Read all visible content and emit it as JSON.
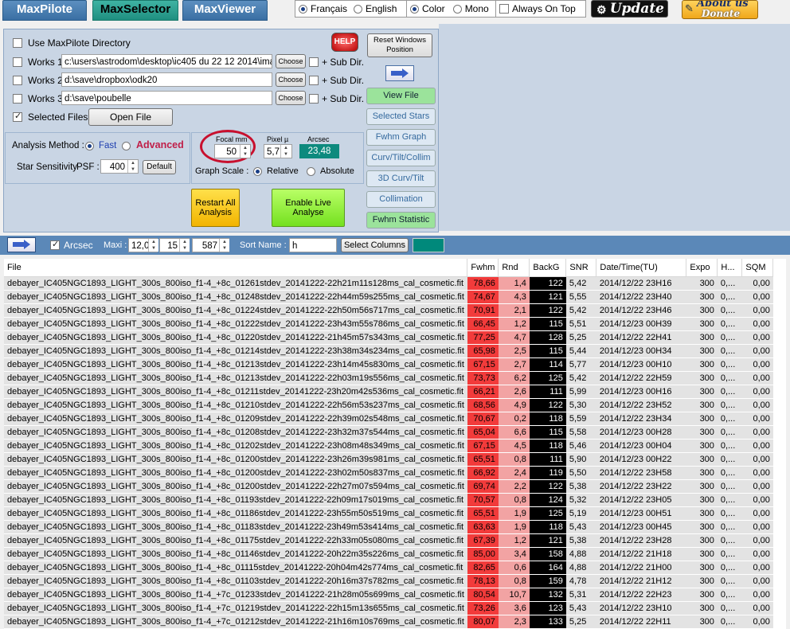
{
  "tabs": [
    {
      "label": "MaxPilote",
      "active": false
    },
    {
      "label": "MaxSelector",
      "active": true
    },
    {
      "label": "MaxViewer",
      "active": false
    }
  ],
  "language": {
    "options": [
      "Français",
      "English"
    ],
    "selected": "Français"
  },
  "display_mode": {
    "options": [
      "Color",
      "Mono"
    ],
    "selected": "Color"
  },
  "always_on_top": {
    "label": "Always On Top",
    "checked": false
  },
  "update_button": "Update",
  "about_button": {
    "line1": "About us",
    "line2": "Donate"
  },
  "directories": {
    "use_maxpilote": {
      "label": "Use MaxPilote Directory",
      "checked": false
    },
    "help_label": "HELP",
    "works": [
      {
        "label": "Works 1",
        "path": "c:\\users\\astrodom\\desktop\\ic405 du 22 12 2014\\imag",
        "choose": "Choose",
        "subdir": "+ Sub Dir."
      },
      {
        "label": "Works 2",
        "path": "d:\\save\\dropbox\\odk20",
        "choose": "Choose",
        "subdir": "+ Sub Dir."
      },
      {
        "label": "Works 3",
        "path": "d:\\save\\poubelle",
        "choose": "Choose",
        "subdir": "+ Sub Dir."
      }
    ],
    "selected_files": {
      "label": "Selected Files :",
      "checked": true
    },
    "open_file": "Open File"
  },
  "analysis": {
    "method_label": "Analysis Method :",
    "fast": "Fast",
    "advanced": "Advanced",
    "selected": "Fast",
    "sensitivity_label": "Star Sensitivity",
    "psf_label": "PSF :",
    "psf_value": "400",
    "default_button": "Default"
  },
  "optics": {
    "focal_label": "Focal mm",
    "focal_value": "50",
    "pixel_label": "Pixel µ",
    "pixel_value": "5,7",
    "arcsec_label": "Arcsec",
    "arcsec_value": "23,48",
    "graph_scale_label": "Graph Scale :",
    "relative": "Relative",
    "absolute": "Absolute",
    "scale_selected": "Relative"
  },
  "actions": {
    "restart": "Restart All Analysis",
    "live": "Enable Live Analyse"
  },
  "side_buttons": [
    {
      "label": "Reset Windows Position",
      "style": "plain"
    },
    {
      "label": "View File",
      "style": "green"
    },
    {
      "label": "Selected Stars",
      "style": "blue"
    },
    {
      "label": "Fwhm Graph",
      "style": "blue"
    },
    {
      "label": "Curv/Tilt/Collim",
      "style": "blue"
    },
    {
      "label": "3D Curv/Tilt",
      "style": "blue"
    },
    {
      "label": "Collimation",
      "style": "blue"
    },
    {
      "label": "Fwhm Statistic",
      "style": "green"
    }
  ],
  "filter_bar": {
    "arcsec_label": "Arcsec",
    "arcsec_checked": true,
    "maxi_label": "Maxi :",
    "maxi_value": "12,0",
    "value2": "15",
    "value3": "587",
    "sort_label": "Sort Name :",
    "sort_value": "h",
    "select_columns": "Select Columns",
    "accent": "#00897b"
  },
  "table": {
    "columns": [
      "File",
      "Fwhm",
      "Rnd",
      "BackG",
      "SNR",
      "Date/Time(TU)",
      "Expo",
      "H...",
      "SQM"
    ],
    "rows": [
      [
        "debayer_IC405NGC1893_LIGHT_300s_800iso_f1-4_+8c_01261stdev_20141222-22h21m11s128ms_cal_cosmetic.fit",
        "78,66",
        "1,4",
        "122",
        "5,42",
        "2014/12/22 23H16",
        "300",
        "0,...",
        "0,00"
      ],
      [
        "debayer_IC405NGC1893_LIGHT_300s_800iso_f1-4_+8c_01248stdev_20141222-22h44m59s255ms_cal_cosmetic.fit",
        "74,67",
        "4,3",
        "121",
        "5,55",
        "2014/12/22 23H40",
        "300",
        "0,...",
        "0,00"
      ],
      [
        "debayer_IC405NGC1893_LIGHT_300s_800iso_f1-4_+8c_01224stdev_20141222-22h50m56s717ms_cal_cosmetic.fit",
        "70,91",
        "2,1",
        "122",
        "5,42",
        "2014/12/22 23H46",
        "300",
        "0,...",
        "0,00"
      ],
      [
        "debayer_IC405NGC1893_LIGHT_300s_800iso_f1-4_+8c_01222stdev_20141222-23h43m55s786ms_cal_cosmetic.fit",
        "66,45",
        "1,2",
        "115",
        "5,51",
        "2014/12/23 00H39",
        "300",
        "0,...",
        "0,00"
      ],
      [
        "debayer_IC405NGC1893_LIGHT_300s_800iso_f1-4_+8c_01220stdev_20141222-21h45m57s343ms_cal_cosmetic.fit",
        "77,25",
        "4,7",
        "128",
        "5,25",
        "2014/12/22 22H41",
        "300",
        "0,...",
        "0,00"
      ],
      [
        "debayer_IC405NGC1893_LIGHT_300s_800iso_f1-4_+8c_01214stdev_20141222-23h38m34s234ms_cal_cosmetic.fit",
        "65,98",
        "2,5",
        "115",
        "5,44",
        "2014/12/23 00H34",
        "300",
        "0,...",
        "0,00"
      ],
      [
        "debayer_IC405NGC1893_LIGHT_300s_800iso_f1-4_+8c_01213stdev_20141222-23h14m45s830ms_cal_cosmetic.fit",
        "67,15",
        "2,7",
        "114",
        "5,77",
        "2014/12/23 00H10",
        "300",
        "0,...",
        "0,00"
      ],
      [
        "debayer_IC405NGC1893_LIGHT_300s_800iso_f1-4_+8c_01213stdev_20141222-22h03m19s556ms_cal_cosmetic.fit",
        "73,73",
        "6,2",
        "125",
        "5,42",
        "2014/12/22 22H59",
        "300",
        "0,...",
        "0,00"
      ],
      [
        "debayer_IC405NGC1893_LIGHT_300s_800iso_f1-4_+8c_01211stdev_20141222-23h20m42s536ms_cal_cosmetic.fit",
        "66,21",
        "2,6",
        "111",
        "5,99",
        "2014/12/23 00H16",
        "300",
        "0,...",
        "0,00"
      ],
      [
        "debayer_IC405NGC1893_LIGHT_300s_800iso_f1-4_+8c_01210stdev_20141222-22h56m53s237ms_cal_cosmetic.fit",
        "68,56",
        "4,9",
        "122",
        "5,30",
        "2014/12/22 23H52",
        "300",
        "0,...",
        "0,00"
      ],
      [
        "debayer_IC405NGC1893_LIGHT_300s_800iso_f1-4_+8c_01209stdev_20141222-22h39m02s548ms_cal_cosmetic.fit",
        "70,67",
        "0,2",
        "118",
        "5,59",
        "2014/12/22 23H34",
        "300",
        "0,...",
        "0,00"
      ],
      [
        "debayer_IC405NGC1893_LIGHT_300s_800iso_f1-4_+8c_01208stdev_20141222-23h32m37s544ms_cal_cosmetic.fit",
        "65,04",
        "6,6",
        "115",
        "5,58",
        "2014/12/23 00H28",
        "300",
        "0,...",
        "0,00"
      ],
      [
        "debayer_IC405NGC1893_LIGHT_300s_800iso_f1-4_+8c_01202stdev_20141222-23h08m48s349ms_cal_cosmetic.fit",
        "67,15",
        "4,5",
        "118",
        "5,46",
        "2014/12/23 00H04",
        "300",
        "0,...",
        "0,00"
      ],
      [
        "debayer_IC405NGC1893_LIGHT_300s_800iso_f1-4_+8c_01200stdev_20141222-23h26m39s981ms_cal_cosmetic.fit",
        "65,51",
        "0,8",
        "111",
        "5,90",
        "2014/12/23 00H22",
        "300",
        "0,...",
        "0,00"
      ],
      [
        "debayer_IC405NGC1893_LIGHT_300s_800iso_f1-4_+8c_01200stdev_20141222-23h02m50s837ms_cal_cosmetic.fit",
        "66,92",
        "2,4",
        "119",
        "5,50",
        "2014/12/22 23H58",
        "300",
        "0,...",
        "0,00"
      ],
      [
        "debayer_IC405NGC1893_LIGHT_300s_800iso_f1-4_+8c_01200stdev_20141222-22h27m07s594ms_cal_cosmetic.fit",
        "69,74",
        "2,2",
        "122",
        "5,38",
        "2014/12/22 23H22",
        "300",
        "0,...",
        "0,00"
      ],
      [
        "debayer_IC405NGC1893_LIGHT_300s_800iso_f1-4_+8c_01193stdev_20141222-22h09m17s019ms_cal_cosmetic.fit",
        "70,57",
        "0,8",
        "124",
        "5,32",
        "2014/12/22 23H05",
        "300",
        "0,...",
        "0,00"
      ],
      [
        "debayer_IC405NGC1893_LIGHT_300s_800iso_f1-4_+8c_01186stdev_20141222-23h55m50s519ms_cal_cosmetic.fit",
        "65,51",
        "1,9",
        "125",
        "5,19",
        "2014/12/23 00H51",
        "300",
        "0,...",
        "0,00"
      ],
      [
        "debayer_IC405NGC1893_LIGHT_300s_800iso_f1-4_+8c_01183stdev_20141222-23h49m53s414ms_cal_cosmetic.fit",
        "63,63",
        "1,9",
        "118",
        "5,43",
        "2014/12/23 00H45",
        "300",
        "0,...",
        "0,00"
      ],
      [
        "debayer_IC405NGC1893_LIGHT_300s_800iso_f1-4_+8c_01175stdev_20141222-22h33m05s080ms_cal_cosmetic.fit",
        "67,39",
        "1,2",
        "121",
        "5,38",
        "2014/12/22 23H28",
        "300",
        "0,...",
        "0,00"
      ],
      [
        "debayer_IC405NGC1893_LIGHT_300s_800iso_f1-4_+8c_01146stdev_20141222-20h22m35s226ms_cal_cosmetic.fit",
        "85,00",
        "3,4",
        "158",
        "4,88",
        "2014/12/22 21H18",
        "300",
        "0,...",
        "0,00"
      ],
      [
        "debayer_IC405NGC1893_LIGHT_300s_800iso_f1-4_+8c_01115stdev_20141222-20h04m42s774ms_cal_cosmetic.fit",
        "82,65",
        "0,6",
        "164",
        "4,88",
        "2014/12/22 21H00",
        "300",
        "0,...",
        "0,00"
      ],
      [
        "debayer_IC405NGC1893_LIGHT_300s_800iso_f1-4_+8c_01103stdev_20141222-20h16m37s782ms_cal_cosmetic.fit",
        "78,13",
        "0,8",
        "159",
        "4,78",
        "2014/12/22 21H12",
        "300",
        "0,...",
        "0,00"
      ],
      [
        "debayer_IC405NGC1893_LIGHT_300s_800iso_f1-4_+7c_01233stdev_20141222-21h28m05s699ms_cal_cosmetic.fit",
        "80,54",
        "10,7",
        "132",
        "5,31",
        "2014/12/22 22H23",
        "300",
        "0,...",
        "0,00"
      ],
      [
        "debayer_IC405NGC1893_LIGHT_300s_800iso_f1-4_+7c_01219stdev_20141222-22h15m13s655ms_cal_cosmetic.fit",
        "73,26",
        "3,6",
        "123",
        "5,43",
        "2014/12/22 23H10",
        "300",
        "0,...",
        "0,00"
      ],
      [
        "debayer_IC405NGC1893_LIGHT_300s_800iso_f1-4_+7c_01212stdev_20141222-21h16m10s769ms_cal_cosmetic.fit",
        "80,07",
        "2,3",
        "133",
        "5,25",
        "2014/12/22 22H11",
        "300",
        "0,...",
        "0,00"
      ]
    ]
  }
}
